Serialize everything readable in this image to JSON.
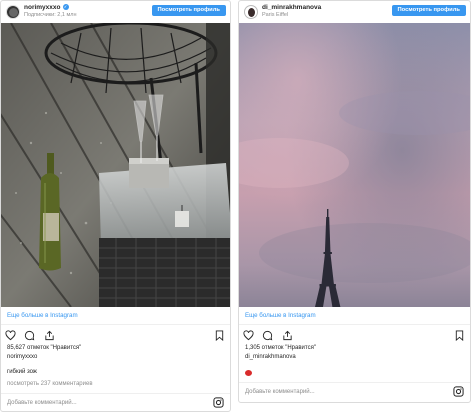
{
  "posts": [
    {
      "username": "norimyxxxo",
      "subline": "Подписчики: 2,1 млн",
      "view_profile_label": "Посмотреть профиль",
      "more_link": "Еще больше в Instagram",
      "likes": "85,627 отметок \"Нравится\"",
      "owner": "norimyxxxo",
      "caption": "гибкий зож",
      "comments_link": "посмотреть 237 комментариев",
      "add_comment_placeholder": "Добавьте комментарий..."
    },
    {
      "username": "di_minrakhmanova",
      "subline": "Paris Eiffel",
      "view_profile_label": "Посмотреть профиль",
      "more_link": "Еще больше в Instagram",
      "likes": "1,305 отметок \"Нравится\"",
      "owner": "di_minrakhmanova",
      "add_comment_placeholder": "Добавьте комментарий..."
    }
  ],
  "colors": {
    "accent": "#3897f0",
    "heart_emoji": "#d92b2b"
  },
  "icons": [
    "heart-icon",
    "comment-icon",
    "share-icon",
    "bookmark-icon",
    "instagram-icon",
    "verified-icon"
  ]
}
